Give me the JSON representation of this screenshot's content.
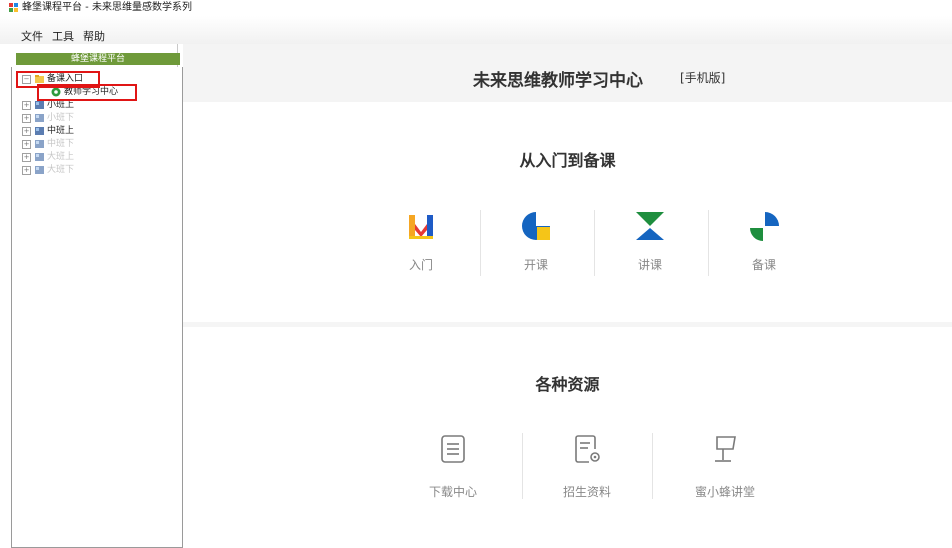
{
  "window": {
    "title": "蜂堡课程平台 - 未来思维量感数学系列"
  },
  "menu": {
    "file": "文件",
    "tools": "工具",
    "help": "帮助"
  },
  "sidebar": {
    "header": "蜂堡课程平台",
    "tree": [
      {
        "label": "备课入口",
        "state": "expanded"
      },
      {
        "label": "教师学习中心",
        "state": "child-selected"
      },
      {
        "label": "小班上",
        "state": "collapsed"
      },
      {
        "label": "小班下",
        "state": "collapsed-disabled"
      },
      {
        "label": "中班上",
        "state": "collapsed"
      },
      {
        "label": "中班下",
        "state": "collapsed-disabled"
      },
      {
        "label": "大班上",
        "state": "collapsed-disabled"
      },
      {
        "label": "大班下",
        "state": "collapsed-disabled"
      }
    ]
  },
  "main": {
    "title": "未来思维教师学习中心",
    "subtitle": "[手机版]",
    "section1": {
      "title": "从入门到备课",
      "items": [
        {
          "label": "入门",
          "icon": "book-icon"
        },
        {
          "label": "开课",
          "icon": "pie-icon"
        },
        {
          "label": "讲课",
          "icon": "hourglass-icon"
        },
        {
          "label": "备课",
          "icon": "quarter-icon"
        }
      ]
    },
    "section2": {
      "title": "各种资源",
      "items": [
        {
          "label": "下载中心",
          "icon": "document-icon"
        },
        {
          "label": "招生资料",
          "icon": "document-settings-icon"
        },
        {
          "label": "蜜小蜂讲堂",
          "icon": "lectern-icon"
        }
      ]
    }
  },
  "colors": {
    "tree_header": "#6f9a3a",
    "highlight_box": "#e01515",
    "blue": "#1565c0",
    "green": "#1e8e3e",
    "yellow": "#f5c518",
    "red": "#e53935"
  }
}
